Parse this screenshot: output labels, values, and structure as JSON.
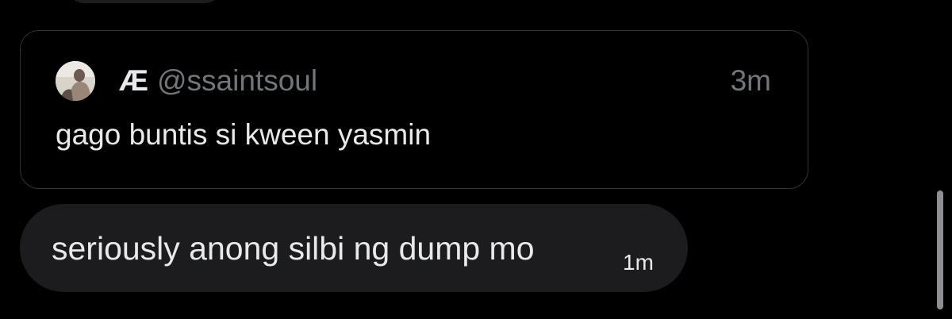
{
  "quote": {
    "name": "Æ",
    "handle": "@ssaintsoul",
    "time": "3m",
    "text": "gago buntis si kween yasmin",
    "avatar_icon": "user-avatar-icon"
  },
  "message": {
    "text": "seriously anong silbi ng dump mo",
    "time": "1m"
  },
  "colors": {
    "background": "#000000",
    "bubble": "#1c1c1e",
    "card_border": "#2f3336",
    "primary_text": "#e7e9ea",
    "secondary_text": "#71767b"
  }
}
